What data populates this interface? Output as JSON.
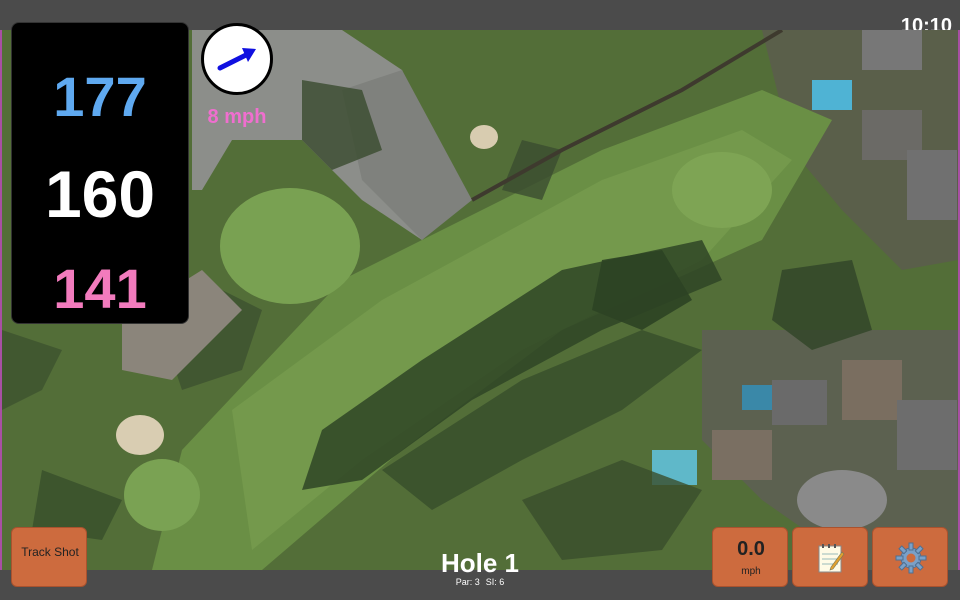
{
  "status": {
    "clock": "10:10"
  },
  "distances": {
    "back": "177",
    "middle": "160",
    "front": "141"
  },
  "wind": {
    "speed_label": "8 mph",
    "icon": "wind-arrow-icon",
    "arrow_color": "#1010e0"
  },
  "hole": {
    "title": "Hole 1",
    "par": "Par: 3",
    "si": "SI: 6"
  },
  "buttons": {
    "track_shot": "Track Shot",
    "speed_value": "0.0",
    "speed_unit": "mph",
    "notes_icon": "notepad-icon",
    "settings_icon": "gear-icon"
  },
  "colors": {
    "back_distance": "#5fa9f0",
    "middle_distance": "#ffffff",
    "front_distance": "#f27bbd",
    "wind_text": "#f06ecf",
    "button": "#cd6b3e",
    "bar": "#4b4b4b"
  }
}
